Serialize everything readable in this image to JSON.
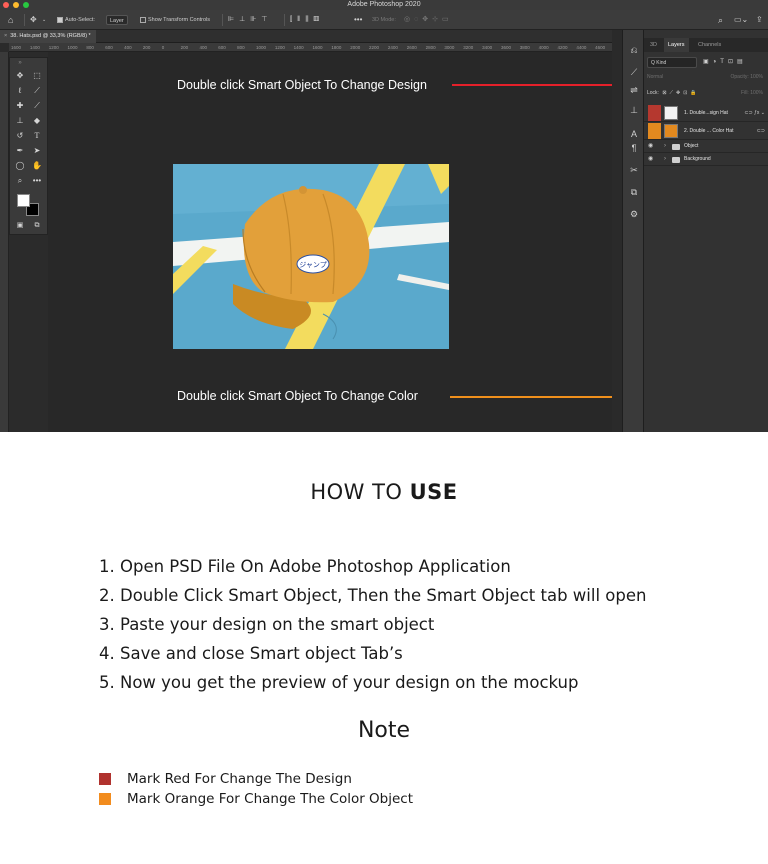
{
  "window": {
    "app_title": "Adobe Photoshop 2020",
    "traffic_lights": {
      "close": "#ff5f57",
      "minimize": "#febc2e",
      "maximize": "#28c840"
    }
  },
  "options_bar": {
    "auto_select_label": "Auto-Select:",
    "auto_select_target": "Layer",
    "transform_controls_label": "Show Transform Controls",
    "mode_3d_label": "3D Mode:"
  },
  "document": {
    "tab_label": "38. Hats.psd @ 33,3% (RGB/8) *",
    "ruler_ticks": [
      "1600",
      "1400",
      "1200",
      "1000",
      "800",
      "600",
      "400",
      "200",
      "0",
      "200",
      "400",
      "600",
      "800",
      "1000",
      "1200",
      "1400",
      "1600",
      "1800",
      "2000",
      "2200",
      "2400",
      "2600",
      "2800",
      "3000",
      "3200",
      "3400",
      "3600",
      "3800",
      "4000",
      "4200",
      "4400",
      "4600"
    ]
  },
  "canvas": {
    "note_design": "Double click Smart Object To Change Design",
    "note_color": "Double click Smart Object To Change Color",
    "cap_label": "ジャンプ"
  },
  "layers_panel": {
    "tabs": [
      "3D",
      "Layers",
      "Channels"
    ],
    "active_tab": "Layers",
    "filter_kind": "Q Kind",
    "blend_mode": "Normal",
    "opacity_label": "Opacity: 100%",
    "lock_label": "Lock:",
    "fill_label": "Fill: 100%",
    "layers": [
      {
        "name": "1. Double...sign Hat",
        "tag_color": "#b5382f"
      },
      {
        "name": "2. Double ... Color Hat",
        "tag_color": "#e2891f"
      }
    ],
    "groups": [
      "Object",
      "Background"
    ]
  },
  "instructions": {
    "heading_prefix": "HOW TO ",
    "heading_bold": "USE",
    "steps": [
      "1. Open PSD File On Adobe Photoshop Application",
      "2. Double Click Smart Object, Then the Smart Object tab will open",
      "3. Paste your design on the smart object",
      "4. Save and close Smart object Tab’s",
      "5. Now you get the preview of your design on the mockup"
    ],
    "note_title": "Note",
    "legend": [
      {
        "label": "Mark Red For Change The Design",
        "color": "#b0322e"
      },
      {
        "label": "Mark Orange For Change The Color Object",
        "color": "#f28c1e"
      }
    ]
  },
  "colors": {
    "red_marker": "#e5202a",
    "orange_marker": "#f0901c"
  }
}
